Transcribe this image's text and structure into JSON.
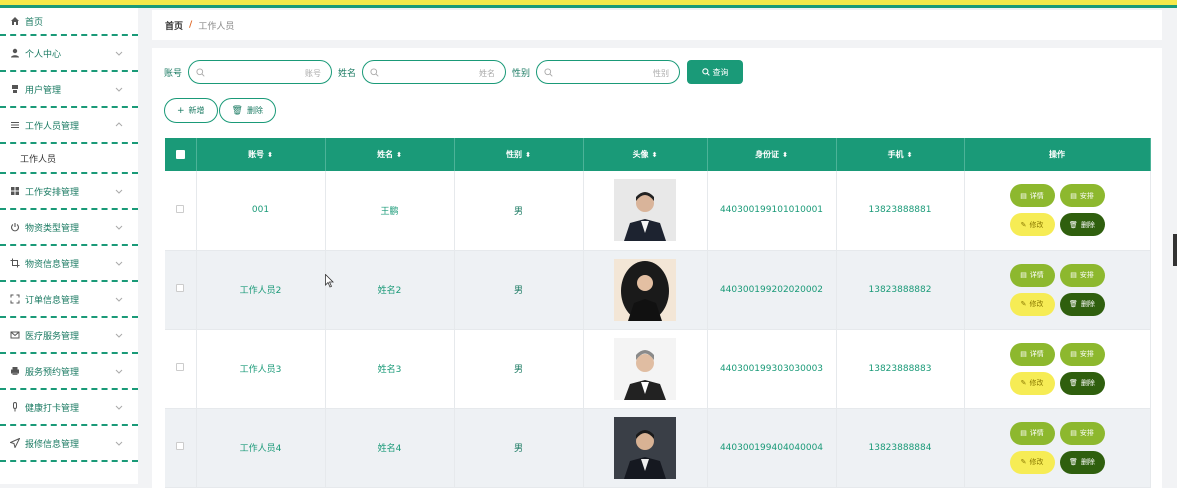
{
  "breadcrumb": {
    "home": "首页",
    "separator": "/",
    "current": "工作人员"
  },
  "sidebar": {
    "items": [
      {
        "label": "首页",
        "icon": "home-icon",
        "expandable": false
      },
      {
        "label": "个人中心",
        "icon": "user-icon",
        "expandable": true
      },
      {
        "label": "用户管理",
        "icon": "users-icon",
        "expandable": true
      },
      {
        "label": "工作人员管理",
        "icon": "list-icon",
        "expandable": true,
        "expanded": true,
        "children": [
          "工作人员"
        ]
      },
      {
        "label": "工作安排管理",
        "icon": "grid-icon",
        "expandable": true
      },
      {
        "label": "物资类型管理",
        "icon": "power-icon",
        "expandable": true
      },
      {
        "label": "物资信息管理",
        "icon": "crop-icon",
        "expandable": true
      },
      {
        "label": "订单信息管理",
        "icon": "frame-icon",
        "expandable": true
      },
      {
        "label": "医疗服务管理",
        "icon": "mail-icon",
        "expandable": true
      },
      {
        "label": "服务预约管理",
        "icon": "printer-icon",
        "expandable": true
      },
      {
        "label": "健康打卡管理",
        "icon": "mic-icon",
        "expandable": true
      },
      {
        "label": "报修信息管理",
        "icon": "send-icon",
        "expandable": true
      }
    ]
  },
  "search": {
    "fields": [
      {
        "label": "账号",
        "placeholder": "账号"
      },
      {
        "label": "姓名",
        "placeholder": "姓名"
      },
      {
        "label": "性别",
        "placeholder": "性别"
      }
    ],
    "button_label": "查询"
  },
  "actions": {
    "add_label": "新增",
    "delete_label": "删除"
  },
  "table": {
    "columns": [
      "账号",
      "姓名",
      "性别",
      "头像",
      "身份证",
      "手机",
      "操作"
    ],
    "rows": [
      {
        "account": "001",
        "name": "王鹏",
        "gender": "男",
        "id_card": "440300199101010001",
        "phone": "13823888881"
      },
      {
        "account": "工作人员2",
        "name": "姓名2",
        "gender": "男",
        "id_card": "440300199202020002",
        "phone": "13823888882"
      },
      {
        "account": "工作人员3",
        "name": "姓名3",
        "gender": "男",
        "id_card": "440300199303030003",
        "phone": "13823888883"
      },
      {
        "account": "工作人员4",
        "name": "姓名4",
        "gender": "男",
        "id_card": "440300199404040004",
        "phone": "13823888884"
      }
    ],
    "row_actions": {
      "detail": "详情",
      "arrange": "安排",
      "edit": "修改",
      "delete": "删除"
    }
  },
  "colors": {
    "primary": "#1a9a78",
    "top_accent": "#f5e94a",
    "op_green": "#8db82e",
    "op_yellow": "#f6ec55",
    "op_dark": "#2f5f0e"
  }
}
